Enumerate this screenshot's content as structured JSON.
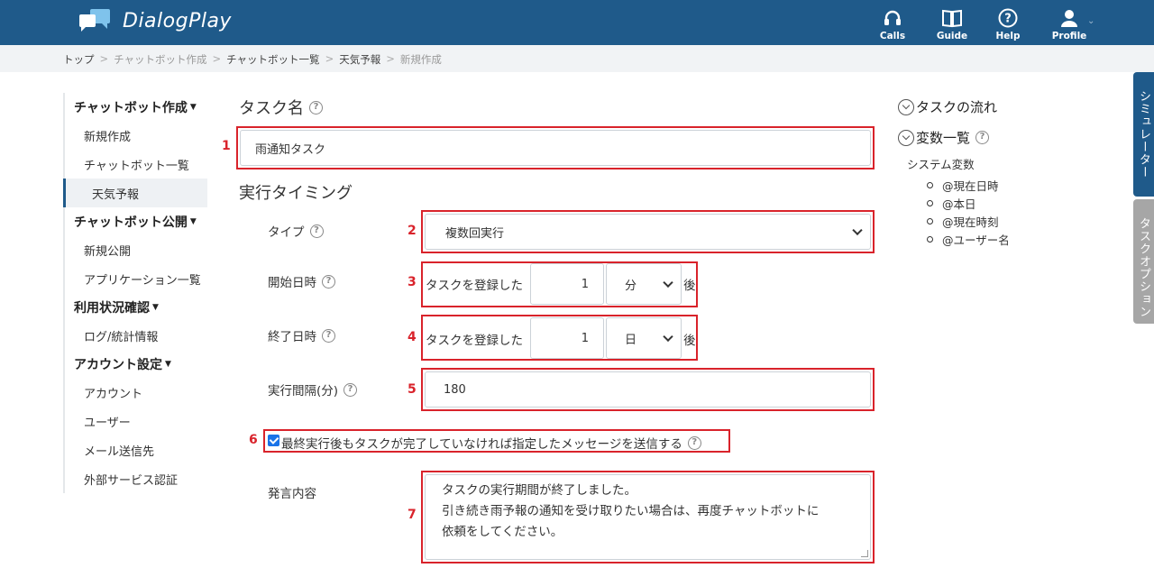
{
  "app": {
    "title": "DialogPlay"
  },
  "nav": {
    "items": [
      {
        "label": "Calls",
        "icon": "headset-icon"
      },
      {
        "label": "Guide",
        "icon": "book-icon"
      },
      {
        "label": "Help",
        "icon": "help-circle-icon"
      },
      {
        "label": "Profile",
        "icon": "user-icon"
      }
    ]
  },
  "breadcrumb": [
    "トップ",
    "チャットボット作成",
    "チャットボット一覧",
    "天気予報",
    "新規作成"
  ],
  "sidebar": {
    "groups": [
      {
        "label": "チャットボット作成",
        "items": [
          "新規作成",
          "チャットボット一覧",
          "天気予報"
        ]
      },
      {
        "label": "チャットボット公開",
        "items": [
          "新規公開",
          "アプリケーション一覧"
        ]
      },
      {
        "label": "利用状況確認",
        "items": [
          "ログ/統計情報"
        ]
      },
      {
        "label": "アカウント設定",
        "items": [
          "アカウント",
          "ユーザー",
          "メール送信先",
          "外部サービス認証"
        ]
      }
    ]
  },
  "form": {
    "task_name_heading": "タスク名",
    "task_name_value": "雨通知タスク",
    "timing_heading": "実行タイミング",
    "type_label": "タイプ",
    "type_value": "複数回実行",
    "start_label": "開始日時",
    "start_prefix": "タスクを登録した",
    "start_value": "1",
    "start_unit": "分",
    "start_suffix": "後",
    "end_label": "終了日時",
    "end_prefix": "タスクを登録した",
    "end_value": "1",
    "end_unit": "日",
    "end_suffix": "後",
    "interval_label": "実行間隔(分)",
    "interval_value": "180",
    "send_message_checkbox_label": "最終実行後もタスクが完了していなければ指定したメッセージを送信する",
    "message_label": "発言内容",
    "message_lines": [
      "タスクの実行期間が終了しました。",
      "引き続き雨予報の通知を受け取りたい場合は、再度チャットボットに",
      "依頼をしてください。"
    ]
  },
  "annotations": [
    "1",
    "2",
    "3",
    "4",
    "5",
    "6",
    "7"
  ],
  "right_panel": {
    "flow_heading": "タスクの流れ",
    "vars_heading": "変数一覧",
    "system_vars_label": "システム変数",
    "system_vars": [
      "@現在日時",
      "@本日",
      "@現在時刻",
      "@ユーザー名"
    ]
  },
  "side_tabs": {
    "simulator": "シミュレーター",
    "task_options": "タスクオプション"
  },
  "colors": {
    "header": "#1f5a8a",
    "annotation_red": "#d9232b",
    "checkbox": "#1a73e8"
  }
}
